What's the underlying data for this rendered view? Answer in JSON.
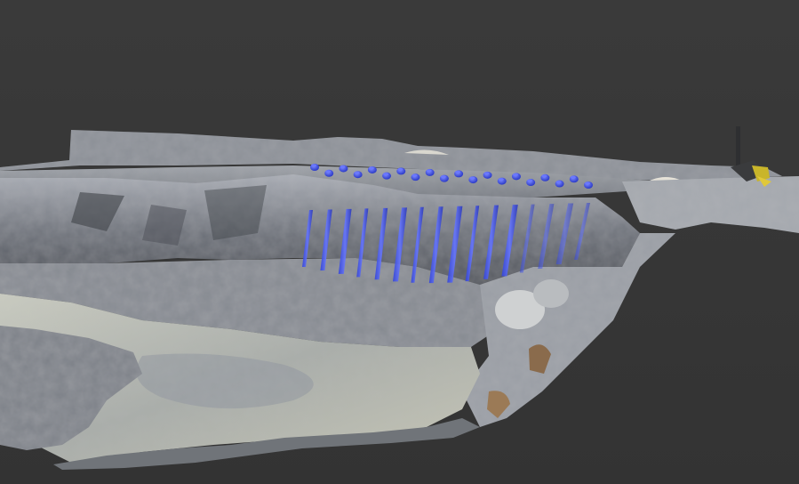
{
  "viewport": {
    "background_top": "#3a3a3a",
    "background_bottom": "#333333"
  },
  "scene": {
    "subject": "3d-photogrammetry-quarry-model",
    "rock_light": "#b8bcc4",
    "rock_mid": "#7c8088",
    "rock_dark": "#3f4248",
    "ground_pale": "#cfd0c4",
    "water_tint": "#8f969e",
    "sand": "#e9e6dd",
    "rust": "#8a6b4c",
    "marker_color": "#2f3fd6",
    "marker_highlight": "#6b78ff",
    "marker_row_count": 20,
    "borehole_count": 16
  }
}
